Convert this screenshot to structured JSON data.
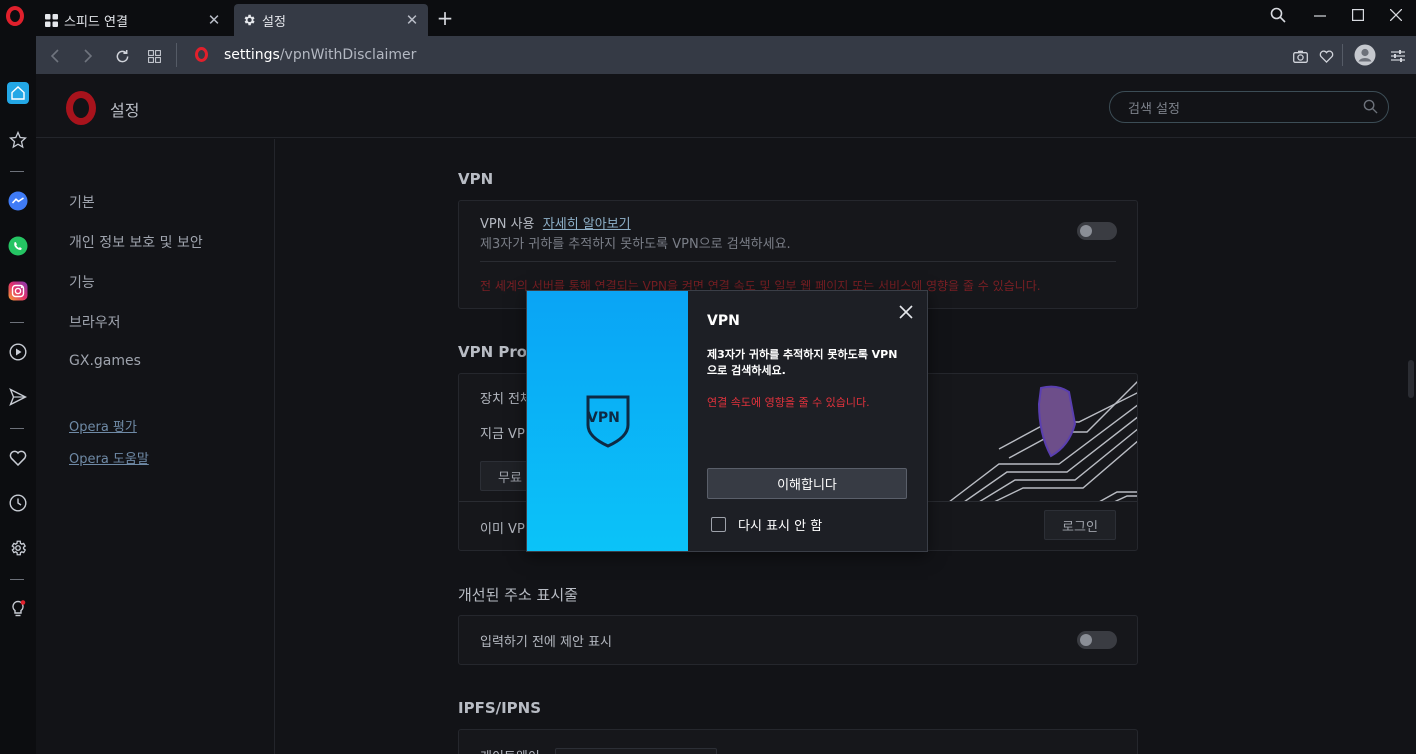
{
  "tabs": [
    {
      "label": "스피드 연결",
      "icon": "grid-icon"
    },
    {
      "label": "설정",
      "icon": "gear-icon"
    }
  ],
  "address": {
    "url_host": "settings",
    "url_path": "/vpnWithDisclaimer"
  },
  "header": {
    "title": "설정",
    "search_placeholder": "검색 설정"
  },
  "nav": {
    "items": [
      "기본",
      "개인 정보 보호 및 보안",
      "기능",
      "브라우저",
      "GX.games"
    ],
    "links": [
      "Opera 평가",
      "Opera 도움말"
    ]
  },
  "vpn": {
    "section_title": "VPN",
    "enable_label": "VPN 사용",
    "learn_more": "자세히 알아보기",
    "description": "제3자가 귀하를 추적하지 못하도록 VPN으로 검색하세요.",
    "warning": "전 세계의 서버를 통해 연결되는 VPN을 켜면 연결 속도 및 일부 웹 페이지 또는 서비스에 영향을 줄 수 있습니다.",
    "enabled": false
  },
  "vpn_pro": {
    "section_title": "VPN Pro",
    "row1_label": "장치 전체",
    "row2_label": "지금 VPN",
    "free_button": "무료",
    "already_label": "이미 VPN",
    "login_button": "로그인"
  },
  "address_bar": {
    "section_title": "개선된 주소 표시줄",
    "suggest_label": "입력하기 전에 제안 표시",
    "enabled": false
  },
  "ipfs": {
    "section_title": "IPFS/IPNS",
    "gateway_label": "게이트웨이"
  },
  "dialog": {
    "title": "VPN",
    "art_label": "VPN",
    "description": "제3자가 귀하를 추적하지 못하도록 VPN으로 검색하세요.",
    "warning": "연결 속도에 영향을 줄 수 있습니다.",
    "confirm_button": "이해합니다",
    "dont_show_label": "다시 표시 안 함",
    "dont_show_checked": false
  },
  "colors": {
    "accent_red": "#e0202c",
    "dialog_gradient_top": "#0aa4f5",
    "dialog_gradient_bottom": "#0bc3f8"
  }
}
